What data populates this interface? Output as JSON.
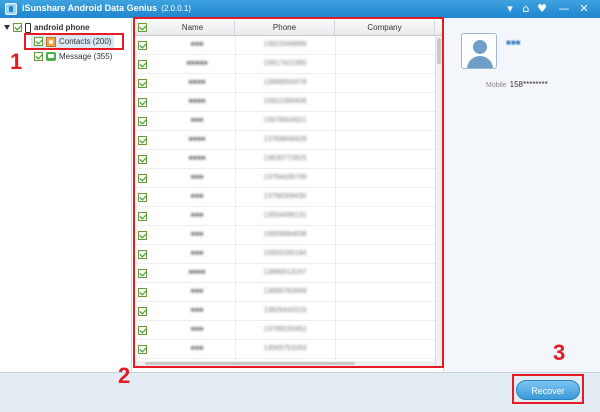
{
  "window": {
    "title": "iSunshare Android Data Genius",
    "version": "(2.0.0.1)",
    "controls": [
      "▾",
      "⌂",
      "♥",
      "—",
      "✕"
    ]
  },
  "tree": {
    "device": "android phone",
    "items": [
      {
        "label": "Contacts (200)",
        "selected": true
      },
      {
        "label": "Message (355)",
        "selected": false
      }
    ]
  },
  "grid": {
    "columns": [
      "Name",
      "Phone",
      "Company"
    ],
    "rows": [
      {
        "name": "■■■",
        "phone": "13922048899",
        "company": ""
      },
      {
        "name": "■■■■■",
        "phone": "15917422390",
        "company": ""
      },
      {
        "name": "■■■■",
        "phone": "13988504478",
        "company": ""
      },
      {
        "name": "■■■■",
        "phone": "15922390406",
        "company": ""
      },
      {
        "name": "■■■",
        "phone": "15978504021",
        "company": ""
      },
      {
        "name": "■■■■",
        "phone": "13769848428",
        "company": ""
      },
      {
        "name": "■■■■",
        "phone": "13630772825",
        "company": ""
      },
      {
        "name": "■■■",
        "phone": "13764436749",
        "company": ""
      },
      {
        "name": "■■■",
        "phone": "13768309430",
        "company": ""
      },
      {
        "name": "■■■",
        "phone": "13554496131",
        "company": ""
      },
      {
        "name": "■■■",
        "phone": "15909984638",
        "company": ""
      },
      {
        "name": "■■■",
        "phone": "15933185194",
        "company": ""
      },
      {
        "name": "■■■■",
        "phone": "13866513197",
        "company": ""
      },
      {
        "name": "■■■",
        "phone": "13699783469",
        "company": ""
      },
      {
        "name": "■■■",
        "phone": "13826443119",
        "company": ""
      },
      {
        "name": "■■■",
        "phone": "13789230452",
        "company": ""
      },
      {
        "name": "■■■",
        "phone": "13565753263",
        "company": ""
      },
      {
        "name": "■■■■",
        "phone": "13620491183",
        "company": ""
      }
    ]
  },
  "detail": {
    "name": "■■■",
    "mobile_label": "Mobile",
    "mobile_value": "158********"
  },
  "footer": {
    "recover_label": "Recover"
  },
  "annotations": {
    "marker1": "1",
    "marker2": "2",
    "marker3": "3"
  },
  "colors": {
    "titlebar": "#1f85cf",
    "highlight": "#e51b24",
    "recover": "#3a9ad9"
  }
}
